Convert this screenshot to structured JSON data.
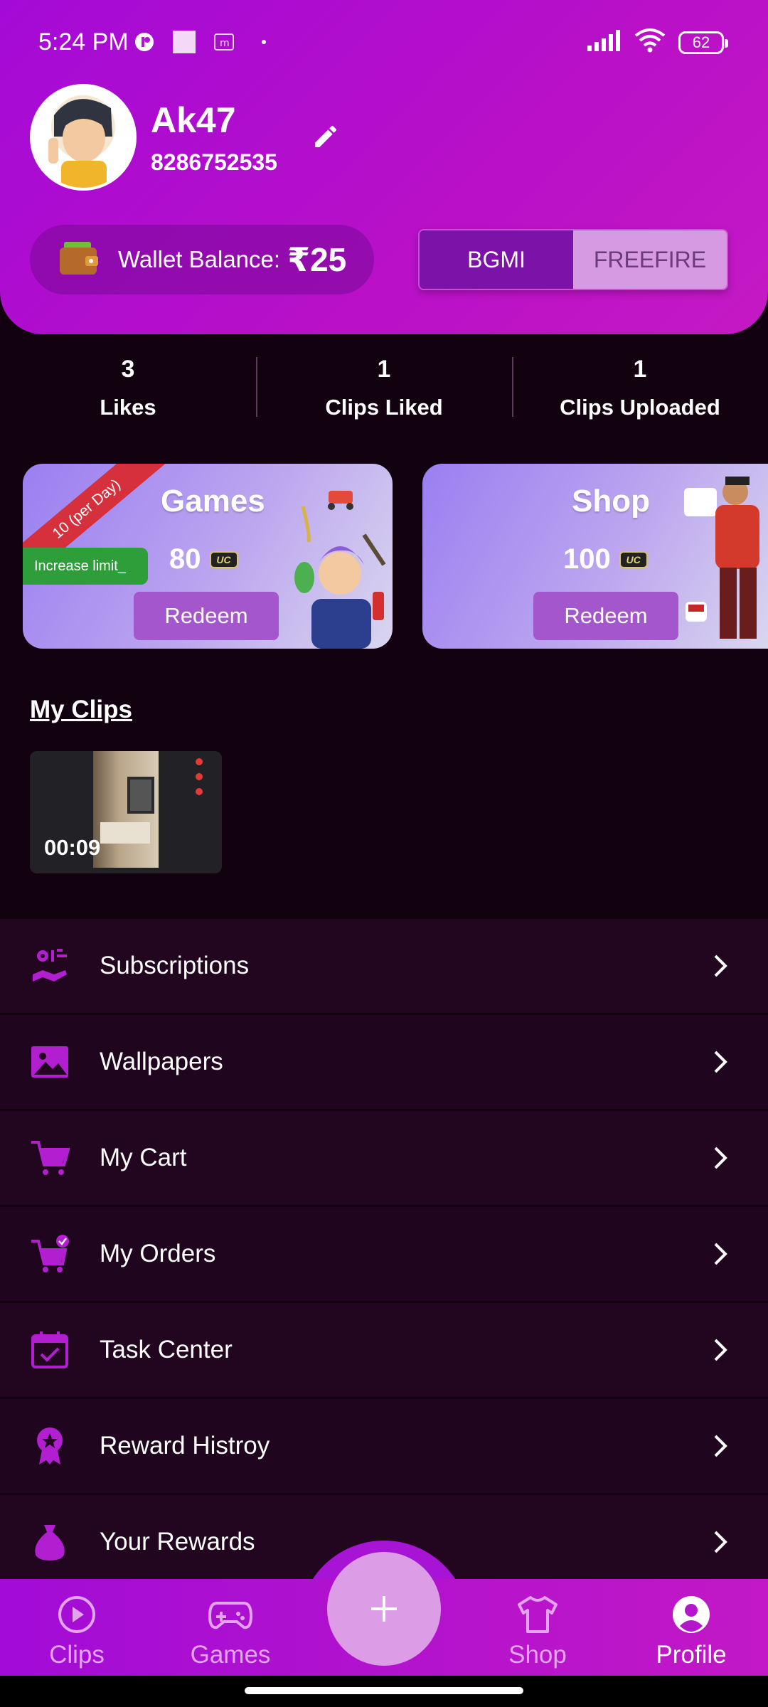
{
  "status_bar": {
    "time": "5:24 PM",
    "battery": "62"
  },
  "profile": {
    "name": "Ak47",
    "phone": "8286752535"
  },
  "wallet": {
    "label": "Wallet Balance:",
    "amount": "₹25"
  },
  "game_toggle": {
    "options": [
      "BGMI",
      "FREEFIRE"
    ],
    "selected": "BGMI"
  },
  "stats": [
    {
      "value": "3",
      "label": "Likes"
    },
    {
      "value": "1",
      "label": "Clips Liked"
    },
    {
      "value": "1",
      "label": "Clips Uploaded"
    }
  ],
  "cards": {
    "games": {
      "title": "Games",
      "value": "80",
      "currency": "UC",
      "button": "Redeem",
      "ribbon": "10 (per Day)",
      "badge": "Increase limit_"
    },
    "shop": {
      "title": "Shop",
      "value": "100",
      "currency": "UC",
      "button": "Redeem"
    }
  },
  "clips": {
    "title": "My Clips",
    "items": [
      {
        "duration": "00:09"
      }
    ]
  },
  "menu": [
    {
      "label": "Subscriptions",
      "icon": "subscriptions-icon"
    },
    {
      "label": "Wallpapers",
      "icon": "image-icon"
    },
    {
      "label": "My Cart",
      "icon": "cart-icon"
    },
    {
      "label": "My Orders",
      "icon": "cart-check-icon"
    },
    {
      "label": "Task Center",
      "icon": "calendar-check-icon"
    },
    {
      "label": "Reward Histroy",
      "icon": "award-icon"
    },
    {
      "label": "Your Rewards",
      "icon": "money-bag-icon"
    }
  ],
  "bottom_nav": [
    {
      "label": "Clips",
      "icon": "play-circle-icon"
    },
    {
      "label": "Games",
      "icon": "gamepad-icon"
    },
    {
      "label": "Shop",
      "icon": "shirt-icon"
    },
    {
      "label": "Profile",
      "icon": "user-circle-icon",
      "active": true
    }
  ],
  "colors": {
    "accent": "#a40ad6",
    "background": "#12020f",
    "menu_icon": "#b21fd0"
  }
}
